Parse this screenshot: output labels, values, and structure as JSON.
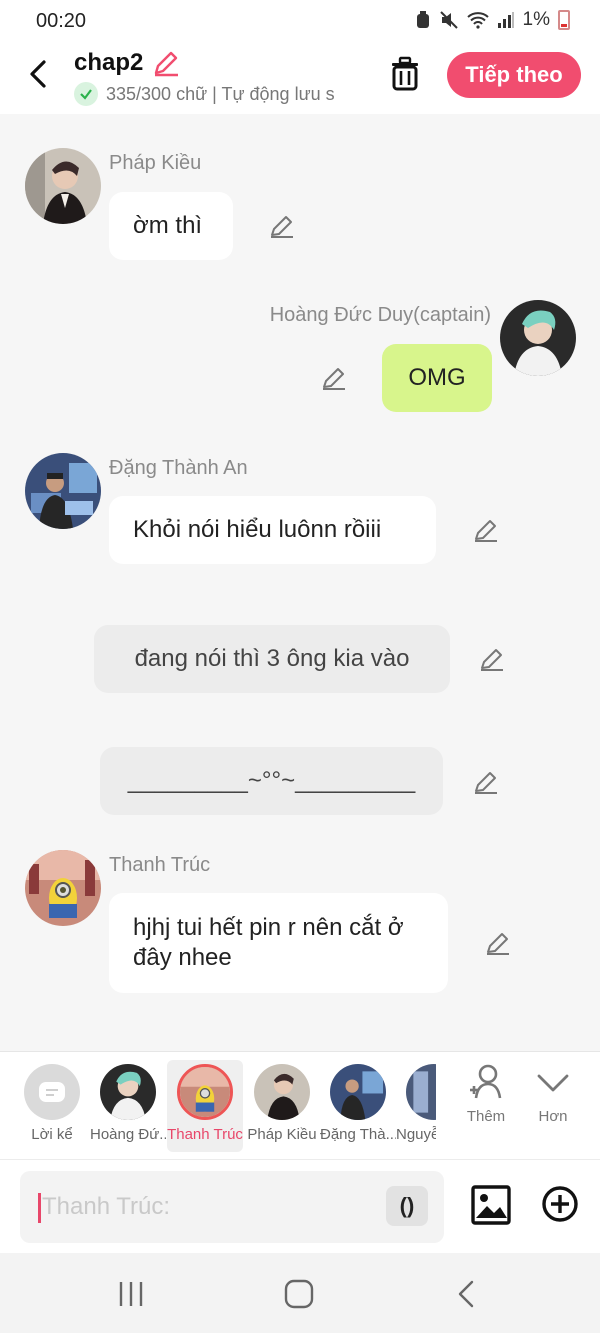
{
  "status_bar": {
    "time": "00:20",
    "battery": "1%"
  },
  "header": {
    "title": "chap2",
    "word_count": "335/300 chữ | Tự động lưu s",
    "next_label": "Tiếp theo"
  },
  "messages": [
    {
      "speaker": "Pháp Kiều",
      "text": "ờm thì"
    },
    {
      "speaker": "Hoàng Đức Duy(captain)",
      "text": "OMG"
    },
    {
      "speaker": "Đặng Thành An",
      "text": "Khỏi nói hiểu luônn rồiii"
    },
    {
      "speaker": "",
      "text": "đang nói thì 3 ông kia vào"
    },
    {
      "speaker": "",
      "text": "_________~°°~_________"
    },
    {
      "speaker": "Thanh Trúc",
      "text": "hjhj tui hết pin r nên cắt ở đây nhee"
    }
  ],
  "characters": [
    {
      "label": "Lời kể"
    },
    {
      "label": "Hoàng Đứ..."
    },
    {
      "label": "Thanh Trúc"
    },
    {
      "label": "Pháp Kiều"
    },
    {
      "label": "Đặng Thà..."
    },
    {
      "label": "Nguyễ"
    }
  ],
  "actions": {
    "add_label": "Thêm",
    "more_label": "Hơn"
  },
  "input": {
    "placeholder": "Thanh Trúc:",
    "paren_label": "()"
  },
  "colors": {
    "accent": "#f14d6f",
    "green_bubble": "#d8f58c",
    "selected": "#e8476a"
  }
}
